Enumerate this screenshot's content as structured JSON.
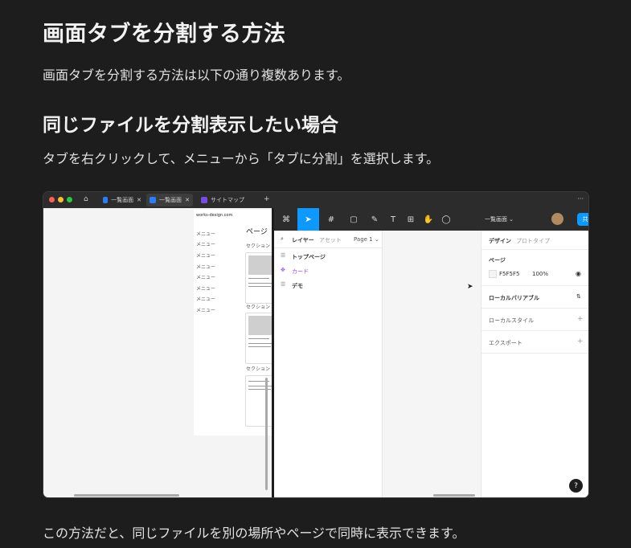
{
  "heading": "画面タブを分割する方法",
  "intro": "画面タブを分割する方法は以下の通り複数あります。",
  "section_title": "同じファイルを分割表示したい場合",
  "section_desc": "タブを右クリックして、メニューから「タブに分割」を選択します。",
  "footer": "この方法だと、同じファイルを別の場所やページで同時に表示できます。",
  "screenshot": {
    "tabs": [
      {
        "label": "一覧画面"
      },
      {
        "label": "一覧画面"
      },
      {
        "label": "サイトマップ"
      }
    ],
    "new_tab": "+",
    "more": "···",
    "left_pane": {
      "site": "works-design.com",
      "menu": [
        "メニュー",
        "メニュー",
        "メニュー",
        "メニュー",
        "メニュー",
        "メニュー",
        "メニュー",
        "メニュー"
      ],
      "page_title": "ページ",
      "sections": [
        "セクション",
        "セクション",
        "セクション"
      ],
      "card_title": "タイトルタイ"
    },
    "right_pane": {
      "file_title": "一覧画面",
      "share": "共",
      "layers_tab": "レイヤー",
      "assets_tab": "アセット",
      "page_select": "Page 1",
      "layers": [
        {
          "name": "トップページ"
        },
        {
          "name": "カード"
        },
        {
          "name": "デモ"
        }
      ],
      "design_tab": "デザイン",
      "prototype_tab": "プロトタイプ",
      "page_label": "ページ",
      "bg_hex": "F5F5F5",
      "bg_opacity": "100%",
      "local_variables": "ローカルバリアブル",
      "local_styles": "ローカルスタイル",
      "export": "エクスポート",
      "help": "?"
    }
  },
  "colors": {
    "background": "#1d1d1d",
    "accent": "#0d99ff",
    "component_purple": "#9747ff"
  }
}
